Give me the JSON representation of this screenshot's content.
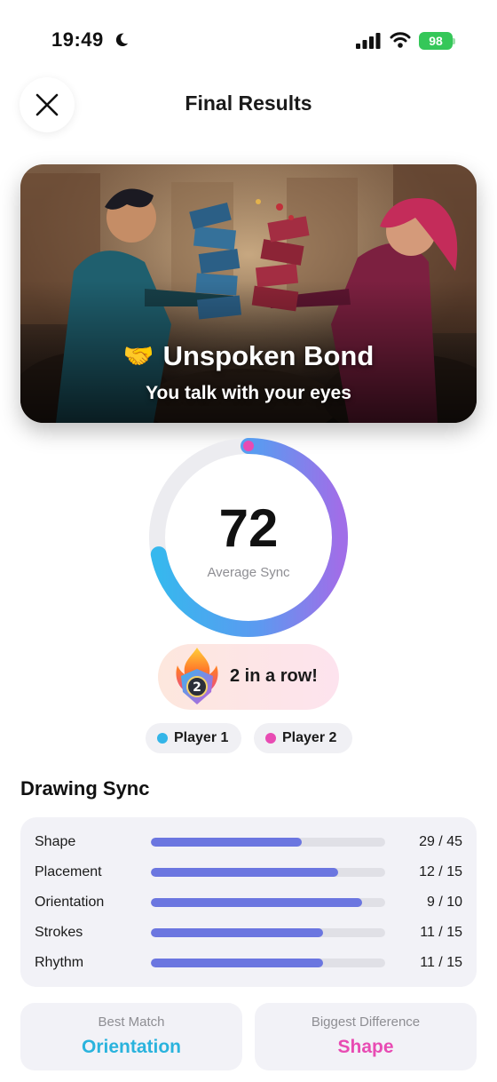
{
  "status_bar": {
    "time": "19:49",
    "battery": "98"
  },
  "header": {
    "title": "Final Results"
  },
  "hero": {
    "emoji": "🤝",
    "title": "Unspoken Bond",
    "subtitle": "You talk with your eyes"
  },
  "sync": {
    "score": "72",
    "label": "Average Sync",
    "fraction": 0.72
  },
  "streak": {
    "badge_number": "2",
    "text": "2 in a row!"
  },
  "players": [
    {
      "label": "Player 1",
      "color": "#33b5e8"
    },
    {
      "label": "Player 2",
      "color": "#e84bb3"
    }
  ],
  "drawing_sync": {
    "title": "Drawing Sync",
    "rows": [
      {
        "label": "Shape",
        "value": "29 / 45",
        "fraction": 0.644
      },
      {
        "label": "Placement",
        "value": "12 / 15",
        "fraction": 0.8
      },
      {
        "label": "Orientation",
        "value": "9 / 10",
        "fraction": 0.9
      },
      {
        "label": "Strokes",
        "value": "11 / 15",
        "fraction": 0.733
      },
      {
        "label": "Rhythm",
        "value": "11 / 15",
        "fraction": 0.733
      }
    ]
  },
  "best_match": {
    "label": "Best Match",
    "value": "Orientation",
    "color": "#2ab3dd"
  },
  "biggest_difference": {
    "label": "Biggest Difference",
    "value": "Shape",
    "color": "#e84bb3"
  },
  "colors": {
    "bar": "#6b76e0",
    "track": "#e0e0e6"
  }
}
